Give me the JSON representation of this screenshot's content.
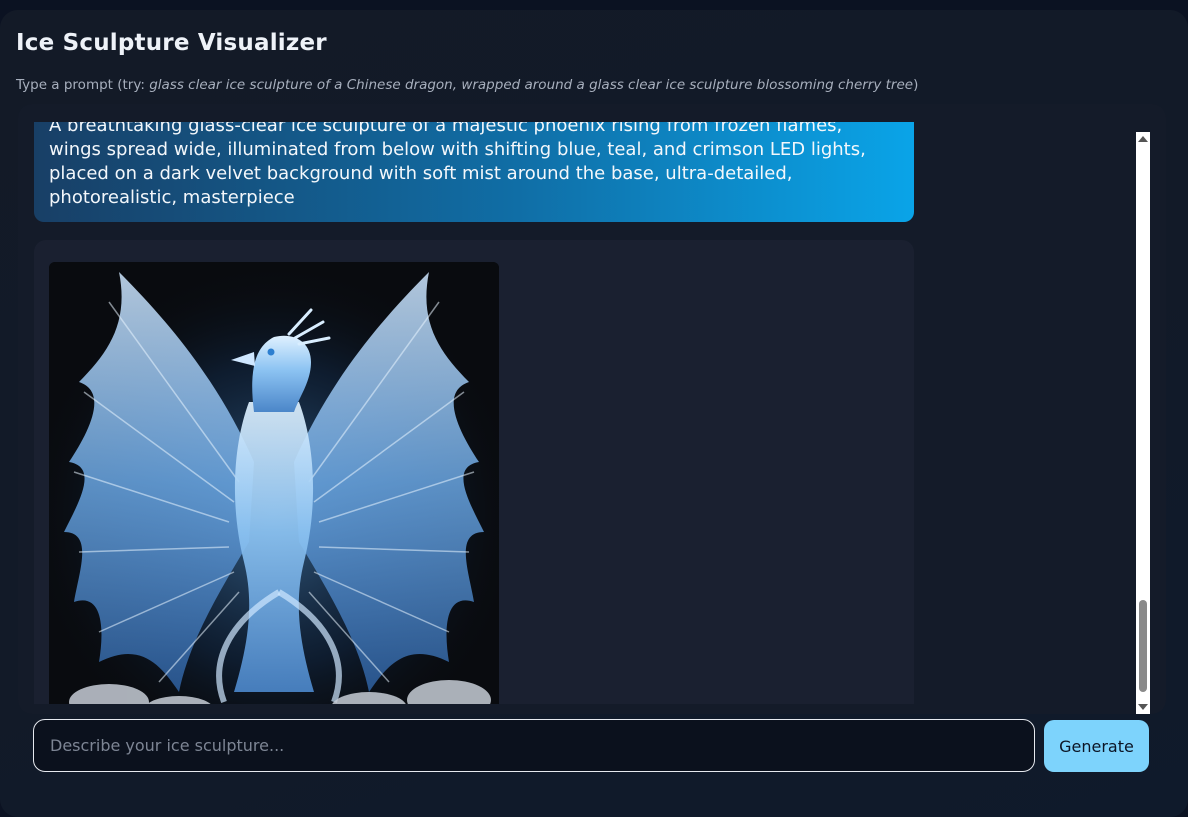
{
  "app": {
    "title": "Ice Sculpture Visualizer",
    "hint_prefix": "Type a prompt (try: ",
    "hint_example": "glass clear ice sculpture of a Chinese dragon, wrapped around a glass clear ice sculpture blossoming cherry tree",
    "hint_suffix": ")"
  },
  "chat": {
    "messages": [
      {
        "role": "user",
        "text": "A breathtaking glass-clear ice sculpture of a majestic phoenix rising from frozen flames, wings spread wide, illuminated from below with shifting blue, teal, and crimson LED lights, placed on a dark velvet background with soft mist around the base, ultra-detailed, photorealistic, masterpiece"
      },
      {
        "role": "assistant",
        "image": "ice-phoenix-sculpture"
      }
    ]
  },
  "composer": {
    "placeholder": "Describe your ice sculpture...",
    "value": "",
    "button_label": "Generate"
  },
  "colors": {
    "accent": "#7dd3fc",
    "user_bubble_start": "#183f66",
    "user_bubble_end": "#0aa4e8",
    "background": "#131a27"
  }
}
